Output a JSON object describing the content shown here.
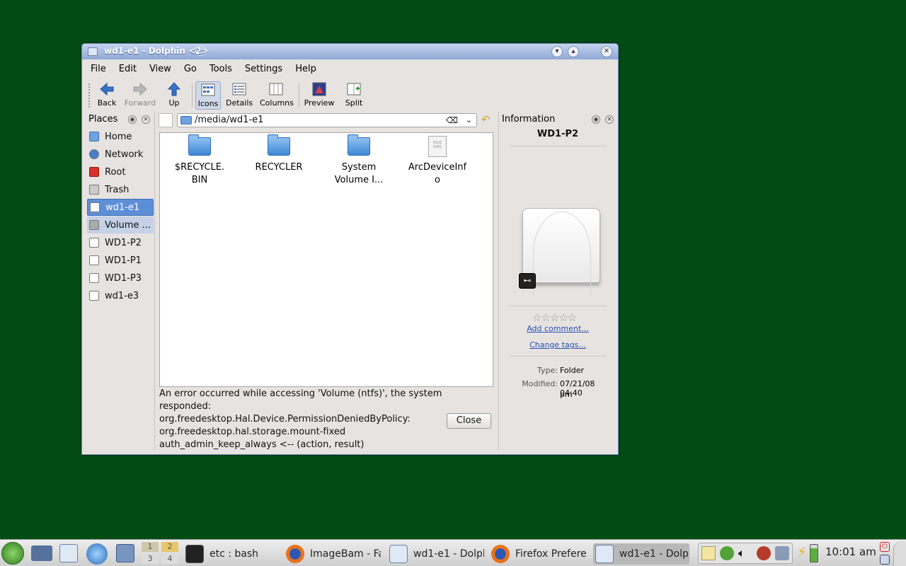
{
  "window": {
    "title": "wd1-e1 - Dolphin <2>",
    "minimize_icon": "chevron-down-icon",
    "maximize_icon": "chevron-up-icon",
    "close_icon": "close-icon"
  },
  "menu": [
    "File",
    "Edit",
    "View",
    "Go",
    "Tools",
    "Settings",
    "Help"
  ],
  "toolbar": {
    "back": "Back",
    "forward": "Forward",
    "up": "Up",
    "icons": "Icons",
    "details": "Details",
    "columns": "Columns",
    "preview": "Preview",
    "split": "Split"
  },
  "places": {
    "title": "Places",
    "items": [
      {
        "label": "Home",
        "icon": "home-folder-icon"
      },
      {
        "label": "Network",
        "icon": "network-icon"
      },
      {
        "label": "Root",
        "icon": "root-folder-icon"
      },
      {
        "label": "Trash",
        "icon": "trash-icon"
      },
      {
        "label": "wd1-e1",
        "icon": "drive-icon",
        "selected": true
      },
      {
        "label": "Volume ...",
        "icon": "hard-disk-icon"
      },
      {
        "label": "WD1-P2",
        "icon": "drive-icon"
      },
      {
        "label": "WD1-P1",
        "icon": "drive-icon"
      },
      {
        "label": "WD1-P3",
        "icon": "drive-icon"
      },
      {
        "label": "wd1-e3",
        "icon": "drive-icon"
      }
    ]
  },
  "location": {
    "path": "/media/wd1-e1"
  },
  "files": [
    {
      "name_line1": "$RECYCLE.",
      "name_line2": "BIN",
      "type": "folder"
    },
    {
      "name_line1": "RECYCLER",
      "name_line2": "",
      "type": "folder"
    },
    {
      "name_line1": "System",
      "name_line2": "Volume I...",
      "type": "folder"
    },
    {
      "name_line1": "ArcDeviceInf",
      "name_line2": "o",
      "type": "binary-file"
    }
  ],
  "error": {
    "line1": "An error occurred while accessing 'Volume (ntfs)', the system",
    "line2": "responded:",
    "line3": "org.freedesktop.Hal.Device.PermissionDeniedByPolicy:",
    "line4": "org.freedesktop.hal.storage.mount-fixed",
    "line5": "auth_admin_keep_always <-- (action, result)",
    "close_label": "Close"
  },
  "info": {
    "title": "Information",
    "name": "WD1-P2",
    "add_comment": "Add comment...",
    "change_tags": "Change tags...",
    "type_label": "Type:",
    "type_value": "Folder",
    "modified_label": "Modified:",
    "modified_value_1": "07/21/08 04:40",
    "modified_value_2": "pm",
    "rating": 0
  },
  "taskbar": {
    "tasks": [
      {
        "label": "etc : bash",
        "icon": "terminal-icon"
      },
      {
        "label": "ImageBam - Fa",
        "icon": "firefox-icon"
      },
      {
        "label": "wd1-e1 - Dolph",
        "icon": "dolphin-icon"
      },
      {
        "label": "Firefox Prefere",
        "icon": "firefox-icon"
      },
      {
        "label": "wd1-e1 - Dolph",
        "icon": "dolphin-icon"
      }
    ],
    "pager": [
      "1",
      "2",
      "3",
      "4"
    ],
    "clock": "10:01 am"
  },
  "colors": {
    "desktop": "#004c14",
    "selection": "#5d8fd8",
    "title_gradient": "#8ea8d6"
  }
}
